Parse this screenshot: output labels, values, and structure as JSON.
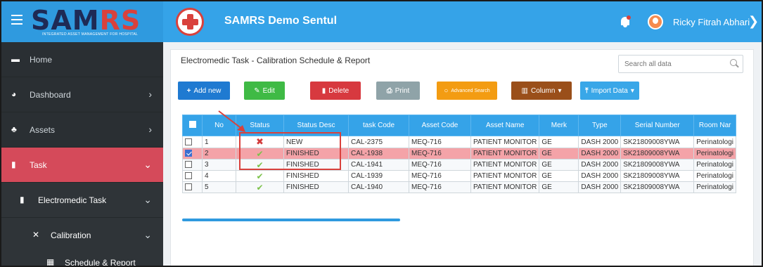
{
  "brand": {
    "logo_main": "SAM",
    "logo_accent": "RS",
    "logo_tagline": "INTEGRATED ASSET MANAGEMENT FOR HOSPITAL"
  },
  "header": {
    "title": "SAMRS Demo Sentul",
    "user_name": "Ricky Fitrah Abhari"
  },
  "sidebar": {
    "items": [
      {
        "label": "Home",
        "icon": "monitor-icon"
      },
      {
        "label": "Dashboard",
        "icon": "dashboard-icon"
      },
      {
        "label": "Assets",
        "icon": "cubes-icon"
      },
      {
        "label": "Task",
        "icon": "file-icon"
      },
      {
        "label": "Electromedic Task",
        "icon": "file-icon"
      },
      {
        "label": "Calibration",
        "icon": "tools-icon"
      },
      {
        "label": "Schedule & Report",
        "icon": "calendar-icon"
      }
    ]
  },
  "page": {
    "title": "Electromedic Task - Calibration Schedule & Report"
  },
  "search": {
    "placeholder": "Search all data"
  },
  "toolbar": {
    "add_label": "Add new",
    "edit_label": "Edit",
    "delete_label": "Delete",
    "print_label": "Print",
    "advanced_label": "Advanced Search",
    "column_label": "Column",
    "import_label": "Import Data"
  },
  "colors": {
    "add": "#1f7ad1",
    "edit": "#3fba45",
    "delete": "#d7393f",
    "print": "#8fa3a8",
    "advanced": "#f39c12",
    "column": "#9a4f1a",
    "import": "#39a7e8"
  },
  "table": {
    "columns": [
      "No",
      "Status",
      "Status Desc",
      "task Code",
      "Asset Code",
      "Asset Name",
      "Merk",
      "Type",
      "Serial Number",
      "Room Nar"
    ],
    "rows": [
      {
        "no": "1",
        "status": "x",
        "desc": "NEW",
        "task": "CAL-2375",
        "asset": "MEQ-716",
        "name": "PATIENT MONITOR",
        "merk": "GE",
        "type": "DASH 2000",
        "serial": "SK21809008YWA",
        "room": "Perinatologi",
        "checked": false
      },
      {
        "no": "2",
        "status": "ok",
        "desc": "FINISHED",
        "task": "CAL-1938",
        "asset": "MEQ-716",
        "name": "PATIENT MONITOR",
        "merk": "GE",
        "type": "DASH 2000",
        "serial": "SK21809008YWA",
        "room": "Perinatologi",
        "checked": true
      },
      {
        "no": "3",
        "status": "ok",
        "desc": "FINISHED",
        "task": "CAL-1941",
        "asset": "MEQ-716",
        "name": "PATIENT MONITOR",
        "merk": "GE",
        "type": "DASH 2000",
        "serial": "SK21809008YWA",
        "room": "Perinatologi",
        "checked": false
      },
      {
        "no": "4",
        "status": "ok",
        "desc": "FINISHED",
        "task": "CAL-1939",
        "asset": "MEQ-716",
        "name": "PATIENT MONITOR",
        "merk": "GE",
        "type": "DASH 2000",
        "serial": "SK21809008YWA",
        "room": "Perinatologi",
        "checked": false
      },
      {
        "no": "5",
        "status": "ok",
        "desc": "FINISHED",
        "task": "CAL-1940",
        "asset": "MEQ-716",
        "name": "PATIENT MONITOR",
        "merk": "GE",
        "type": "DASH 2000",
        "serial": "SK21809008YWA",
        "room": "Perinatologi",
        "checked": false
      }
    ]
  }
}
